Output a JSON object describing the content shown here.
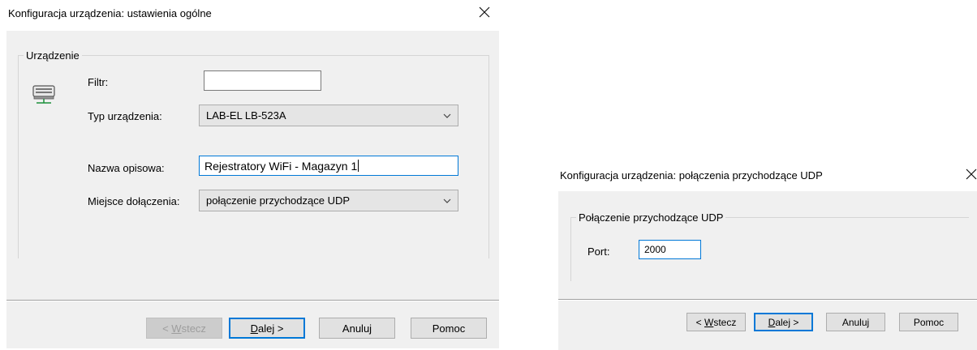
{
  "general_dialog": {
    "title": "Konfiguracja urządzenia: ustawienia ogólne",
    "close_icon": "close-icon",
    "group_label": "Urządzenie",
    "device_icon": "network-device-icon",
    "filter_label": "Filtr:",
    "filter_value": "",
    "device_type_label": "Typ urządzenia:",
    "device_type_value": "LAB-EL LB-523A",
    "description_label": "Nazwa opisowa:",
    "description_value": "Rejestratory WiFi - Magazyn 1",
    "attach_label": "Miejsce dołączenia:",
    "attach_value": "połączenie przychodzące UDP",
    "buttons": {
      "back_prefix": "< ",
      "back_mnemonic": "W",
      "back_rest": "stecz",
      "next_mnemonic": "D",
      "next_rest": "alej >",
      "cancel": "Anuluj",
      "help": "Pomoc"
    }
  },
  "udp_dialog": {
    "title": "Konfiguracja urządzenia: połączenia przychodzące UDP",
    "close_icon": "close-icon",
    "group_label": "Połączenie przychodzące UDP",
    "port_label": "Port:",
    "port_value": "2000",
    "buttons": {
      "back_prefix": "< ",
      "back_mnemonic": "W",
      "back_rest": "stecz",
      "next_mnemonic": "D",
      "next_rest": "alej >",
      "cancel": "Anuluj",
      "help": "Pomoc"
    }
  },
  "colors": {
    "accent": "#0078d7",
    "dialog_bg": "#f0f0f0",
    "title_bg": "#ffffff"
  }
}
